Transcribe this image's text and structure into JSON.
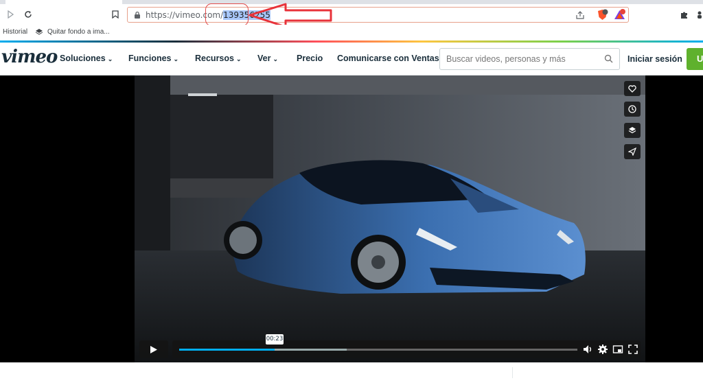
{
  "browser": {
    "url_prefix": "https://vimeo.com/",
    "url_selected": "139356255",
    "bookmarks": [
      {
        "label": "Historial"
      },
      {
        "label": "Quitar fondo a ima..."
      }
    ]
  },
  "header": {
    "logo": "vimeo",
    "nav": [
      {
        "label": "Soluciones",
        "dropdown": true
      },
      {
        "label": "Funciones",
        "dropdown": true
      },
      {
        "label": "Recursos",
        "dropdown": true
      },
      {
        "label": "Ver",
        "dropdown": true
      },
      {
        "label": "Precio",
        "dropdown": false
      },
      {
        "label": "Comunicarse con Ventas",
        "dropdown": false
      }
    ],
    "search_placeholder": "Buscar videos, personas y más",
    "login": "Iniciar sesión",
    "join": "U"
  },
  "player": {
    "time_tooltip": "00:23",
    "progress_played": 0.24,
    "progress_loaded": 0.42
  },
  "colors": {
    "accent": "#00adef",
    "join_button": "#5fb12d",
    "brand_text": "#1a2e3b",
    "annotation": "#e24a4a"
  }
}
